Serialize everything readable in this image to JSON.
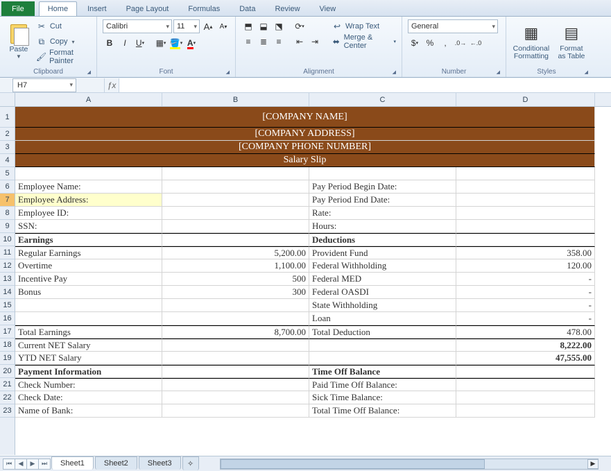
{
  "tabs": {
    "file": "File",
    "home": "Home",
    "insert": "Insert",
    "pagelayout": "Page Layout",
    "formulas": "Formulas",
    "data": "Data",
    "review": "Review",
    "view": "View"
  },
  "ribbon": {
    "clipboard": {
      "paste": "Paste",
      "cut": "Cut",
      "copy": "Copy",
      "fmtpainter": "Format Painter",
      "label": "Clipboard"
    },
    "font": {
      "name": "Calibri",
      "size": "11",
      "label": "Font"
    },
    "alignment": {
      "wrap": "Wrap Text",
      "merge": "Merge & Center",
      "label": "Alignment"
    },
    "number": {
      "format": "General",
      "label": "Number"
    },
    "styles": {
      "cond": "Conditional Formatting",
      "table": "Format as Table",
      "label": "Styles"
    }
  },
  "namebox": "H7",
  "columns": [
    "A",
    "B",
    "C",
    "D"
  ],
  "rows": [
    "1",
    "2",
    "3",
    "4",
    "5",
    "6",
    "7",
    "8",
    "9",
    "10",
    "11",
    "12",
    "13",
    "14",
    "15",
    "16",
    "17",
    "18",
    "19",
    "20",
    "21",
    "22",
    "23"
  ],
  "sheet": {
    "company": "[COMPANY NAME]",
    "address": "[COMPANY ADDRESS]",
    "phone": "[COMPANY PHONE NUMBER]",
    "title": "Salary Slip",
    "r6a": "Employee Name:",
    "r6c": "Pay Period Begin Date:",
    "r7a": "Employee Address:",
    "r7c": "Pay Period End Date:",
    "r8a": "Employee ID:",
    "r8c": "Rate:",
    "r9a": "SSN:",
    "r9c": "Hours:",
    "r10a": "Earnings",
    "r10c": "Deductions",
    "r11a": "Regular Earnings",
    "r11b": "5,200.00",
    "r11c": "Provident Fund",
    "r11d": "358.00",
    "r12a": "Overtime",
    "r12b": "1,100.00",
    "r12c": "Federal Withholding",
    "r12d": "120.00",
    "r13a": "Incentive Pay",
    "r13b": "500",
    "r13c": "Federal MED",
    "r13d": "-",
    "r14a": "Bonus",
    "r14b": "300",
    "r14c": "Federal OASDI",
    "r14d": "-",
    "r15c": "State Withholding",
    "r15d": "-",
    "r16c": "Loan",
    "r16d": "-",
    "r17a": "Total Earnings",
    "r17b": "8,700.00",
    "r17c": "Total Deduction",
    "r17d": "478.00",
    "r18a": "Current NET Salary",
    "r18d": "8,222.00",
    "r19a": "YTD NET Salary",
    "r19d": "47,555.00",
    "r20a": "Payment Information",
    "r20c": "Time Off Balance",
    "r21a": "Check  Number:",
    "r21c": "Paid Time Off Balance:",
    "r22a": "Check Date:",
    "r22c": "Sick Time Balance:",
    "r23a": "Name of Bank:",
    "r23c": "Total Time Off Balance:"
  },
  "sheets": {
    "s1": "Sheet1",
    "s2": "Sheet2",
    "s3": "Sheet3"
  }
}
